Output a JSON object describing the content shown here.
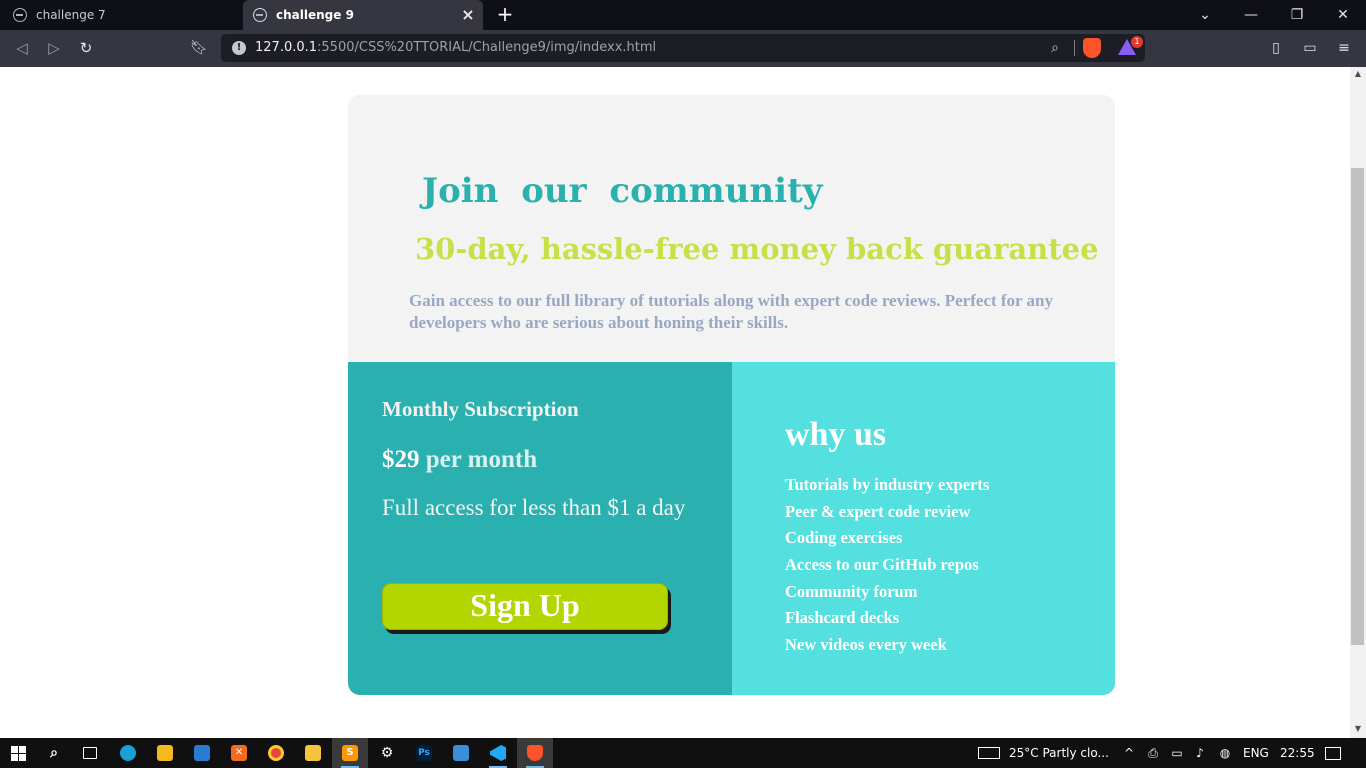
{
  "browser": {
    "tabs": [
      {
        "title": "challenge 7",
        "active": false
      },
      {
        "title": "challenge 9",
        "active": true
      }
    ],
    "new_tab": "+",
    "url_host": "127.0.0.1",
    "url_rest": ":5500/CSS%20TTORIAL/Challenge9/img/indexx.html",
    "rewards_count": "1",
    "window_controls": {
      "minimize": "—",
      "restore": "❐",
      "close": "✕",
      "tab_search": "⌄"
    }
  },
  "page": {
    "heading": "Join our community",
    "guarantee": "30-day, hassle-free money back guarantee",
    "description": "Gain access to our full library of tutorials along with expert code reviews. Perfect for any developers who are serious about honing their skills.",
    "subscription": {
      "title": "Monthly Subscription",
      "price": "$29",
      "per": "per month",
      "access": "Full access for less than $1 a day",
      "signup_label": "Sign Up"
    },
    "why": {
      "title": "why us",
      "items": [
        "Tutorials by industry experts",
        "Peer & expert code review",
        "Coding exercises",
        "Access to our GitHub repos",
        "Community forum",
        "Flashcard decks",
        "New videos every week"
      ]
    },
    "colors": {
      "teal": "#2ab0ae",
      "light_cyan": "#53e0df",
      "lime": "#c6e047",
      "button": "#b3d600",
      "muted_text": "#98a8c4"
    }
  },
  "taskbar": {
    "weather": "25°C  Partly clo...",
    "language": "ENG",
    "time": "22:55"
  }
}
